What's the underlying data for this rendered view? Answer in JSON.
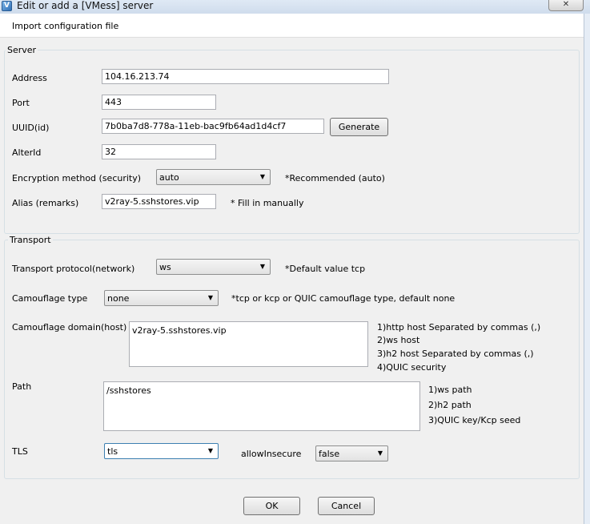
{
  "window": {
    "title": "Edit or add a [VMess] server",
    "close_label": "✕"
  },
  "menu": {
    "import_label": "Import configuration file"
  },
  "server": {
    "group_title": "Server",
    "address_label": "Address",
    "address_value": "104.16.213.74",
    "port_label": "Port",
    "port_value": "443",
    "uuid_label": "UUID(id)",
    "uuid_value": "7b0ba7d8-778a-11eb-bac9fb64ad1d4cf7",
    "generate_label": "Generate",
    "alterid_label": "AlterId",
    "alterid_value": "32",
    "security_label": "Encryption method (security)",
    "security_value": "auto",
    "security_hint": "*Recommended (auto)",
    "alias_label": "Alias (remarks)",
    "alias_value": "v2ray-5.sshstores.vip",
    "alias_hint": "* Fill in manually"
  },
  "transport": {
    "group_title": "Transport",
    "network_label": "Transport protocol(network)",
    "network_value": "ws",
    "network_hint": "*Default value tcp",
    "camouflage_type_label": "Camouflage type",
    "camouflage_type_value": "none",
    "camouflage_type_hint": "*tcp or kcp or QUIC camouflage type, default none",
    "host_label": "Camouflage domain(host)",
    "host_value": "v2ray-5.sshstores.vip",
    "host_hints": [
      "1)http host Separated by commas (,)",
      "2)ws host",
      "3)h2 host Separated by commas (,)",
      "4)QUIC security"
    ],
    "path_label": "Path",
    "path_value": "/sshstores",
    "path_hints": [
      "1)ws path",
      "2)h2 path",
      "3)QUIC key/Kcp seed"
    ],
    "tls_label": "TLS",
    "tls_value": "tls",
    "allow_insecure_label": "allowInsecure",
    "allow_insecure_value": "false"
  },
  "footer": {
    "ok_label": "OK",
    "cancel_label": "Cancel"
  }
}
